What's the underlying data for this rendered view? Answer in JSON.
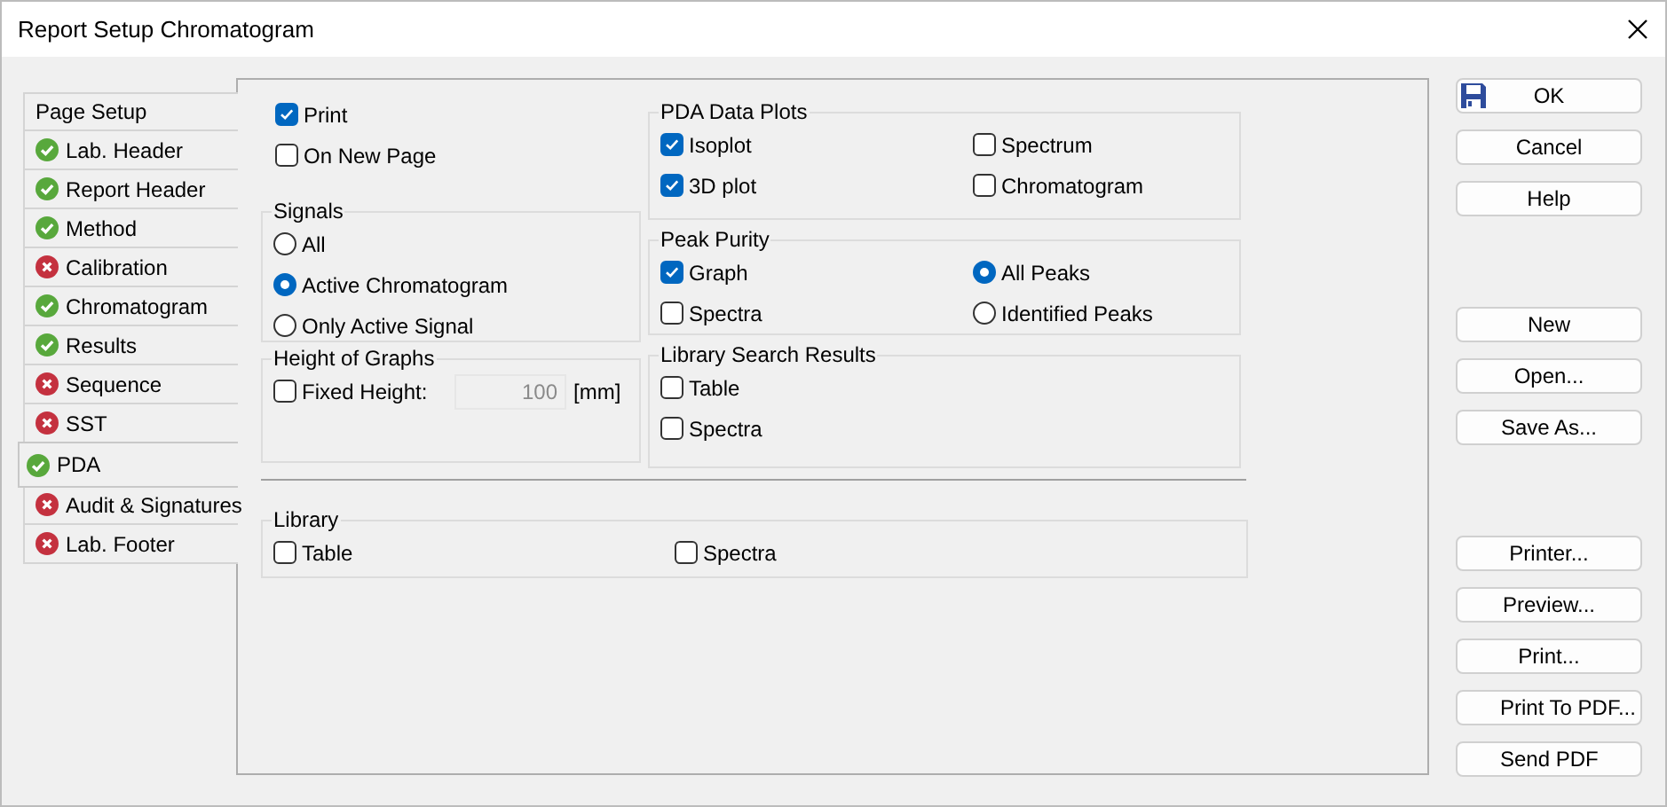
{
  "window": {
    "title": "Report Setup Chromatogram"
  },
  "tabs": [
    {
      "kind": "plain",
      "label": "Page Setup",
      "selected": false
    },
    {
      "kind": "ok",
      "label": "Lab. Header",
      "selected": false
    },
    {
      "kind": "ok",
      "label": "Report Header",
      "selected": false
    },
    {
      "kind": "ok",
      "label": "Method",
      "selected": false
    },
    {
      "kind": "error",
      "label": "Calibration",
      "selected": false
    },
    {
      "kind": "ok",
      "label": "Chromatogram",
      "selected": false
    },
    {
      "kind": "ok",
      "label": "Results",
      "selected": false
    },
    {
      "kind": "error",
      "label": "Sequence",
      "selected": false
    },
    {
      "kind": "error",
      "label": "SST",
      "selected": false
    },
    {
      "kind": "ok",
      "label": "PDA",
      "selected": true
    },
    {
      "kind": "error",
      "label": "Audit & Signatures",
      "selected": false
    },
    {
      "kind": "error",
      "label": "Lab. Footer",
      "selected": false
    }
  ],
  "options": [
    {
      "kind": "checkbox",
      "label": "Print",
      "checked": true
    },
    {
      "kind": "checkbox",
      "label": "On New Page",
      "checked": false
    }
  ],
  "left_groups": [
    {
      "title": "Signals",
      "rows": [
        [
          {
            "kind": "radio",
            "label": "All",
            "selected": false
          }
        ],
        [
          {
            "kind": "radio",
            "label": "Active Chromatogram",
            "selected": true
          }
        ],
        [
          {
            "kind": "radio",
            "label": "Only Active Signal",
            "selected": false
          }
        ]
      ]
    },
    {
      "title": "Height of Graphs",
      "rows": [
        [
          {
            "kind": "checkbox",
            "label": "Fixed Height:",
            "checked": false
          },
          {
            "kind": "field",
            "value": "100",
            "unit": "[mm]",
            "disabled": true
          }
        ]
      ]
    }
  ],
  "right_groups": [
    {
      "title": "PDA Data Plots",
      "rows": [
        [
          {
            "kind": "checkbox",
            "label": "Isoplot",
            "checked": true
          },
          {
            "kind": "checkbox",
            "label": "Spectrum",
            "checked": false
          }
        ],
        [
          {
            "kind": "checkbox",
            "label": "3D plot",
            "checked": true
          },
          {
            "kind": "checkbox",
            "label": "Chromatogram",
            "checked": false
          }
        ]
      ]
    },
    {
      "title": "Peak Purity",
      "rows": [
        [
          {
            "kind": "checkbox",
            "label": "Graph",
            "checked": true
          },
          {
            "kind": "radio",
            "label": "All Peaks",
            "selected": true
          }
        ],
        [
          {
            "kind": "checkbox",
            "label": "Spectra",
            "checked": false
          },
          {
            "kind": "radio",
            "label": "Identified Peaks",
            "selected": false
          }
        ]
      ]
    },
    {
      "title": "Library Search Results",
      "rows": [
        [
          {
            "kind": "checkbox",
            "label": "Table",
            "checked": false
          }
        ],
        [
          {
            "kind": "checkbox",
            "label": "Spectra",
            "checked": false
          }
        ]
      ]
    }
  ],
  "library": {
    "title": "Library",
    "rows": [
      [
        {
          "kind": "checkbox",
          "label": "Table",
          "checked": false
        },
        {
          "kind": "checkbox",
          "label": "Spectra",
          "checked": false
        }
      ]
    ]
  },
  "button_groups": [
    [
      {
        "kind": "save",
        "label": "OK"
      },
      {
        "kind": "plain",
        "label": "Cancel"
      },
      {
        "kind": "plain",
        "label": "Help"
      }
    ],
    [
      {
        "kind": "plain",
        "label": "New"
      },
      {
        "kind": "plain",
        "label": "Open..."
      },
      {
        "kind": "plain",
        "label": "Save As..."
      }
    ],
    [
      {
        "kind": "plain",
        "label": "Printer..."
      },
      {
        "kind": "plain",
        "label": "Preview..."
      },
      {
        "kind": "plain",
        "label": "Print..."
      },
      {
        "kind": "plain",
        "label": "Print To PDF..."
      },
      {
        "kind": "plain",
        "label": "Send PDF"
      }
    ]
  ]
}
